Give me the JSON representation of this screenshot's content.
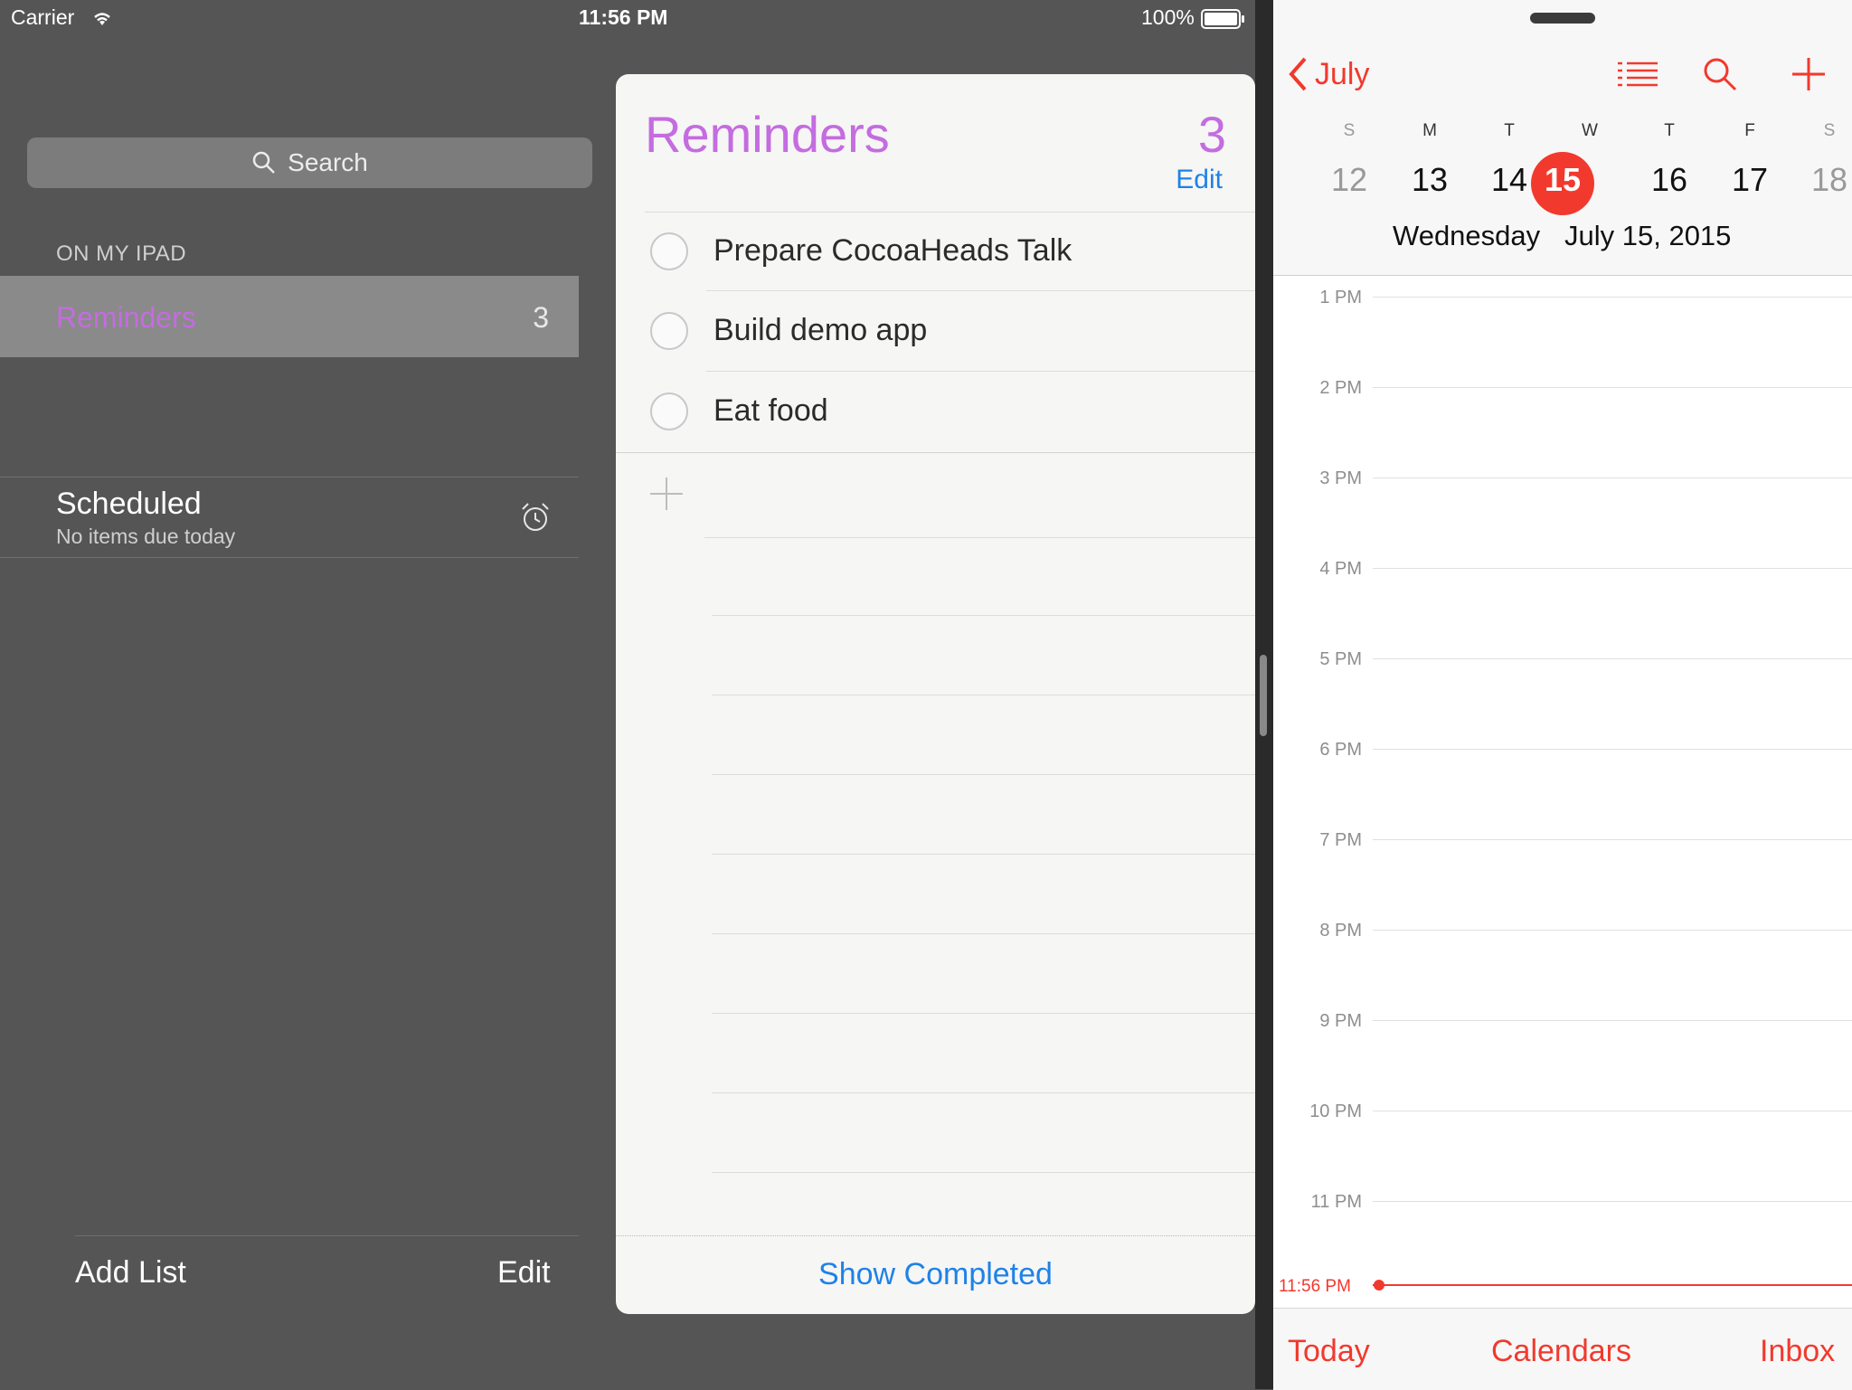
{
  "status_bar": {
    "carrier": "Carrier",
    "time": "11:56 PM",
    "battery": "100%"
  },
  "sidebar": {
    "search_placeholder": "Search",
    "section_header": "ON MY IPAD",
    "lists": [
      {
        "name": "Reminders",
        "count": "3"
      }
    ],
    "scheduled": {
      "title": "Scheduled",
      "subtitle": "No items due today",
      "icon": "alarm-clock-icon"
    },
    "footer": {
      "add_list": "Add List",
      "edit": "Edit"
    }
  },
  "reminders": {
    "title": "Reminders",
    "count": "3",
    "edit": "Edit",
    "items": [
      {
        "text": "Prepare CocoaHeads Talk",
        "completed": false
      },
      {
        "text": "Build demo app",
        "completed": false
      },
      {
        "text": "Eat food",
        "completed": false
      }
    ],
    "show_completed": "Show Completed",
    "accent": "#c46ce0",
    "link_color": "#1e82e8"
  },
  "calendar": {
    "month_back": "July",
    "day_letters": [
      "S",
      "M",
      "T",
      "W",
      "T",
      "F",
      "S"
    ],
    "day_numbers": [
      "12",
      "13",
      "14",
      "15",
      "16",
      "17",
      "18"
    ],
    "selected_day": "15",
    "date_weekday": "Wednesday",
    "date_full": "July 15, 2015",
    "hours": [
      "1 PM",
      "2 PM",
      "3 PM",
      "4 PM",
      "5 PM",
      "6 PM",
      "7 PM",
      "8 PM",
      "9 PM",
      "10 PM",
      "11 PM"
    ],
    "current_time": "11:56 PM",
    "footer": {
      "today": "Today",
      "calendars": "Calendars",
      "inbox": "Inbox"
    },
    "accent": "#f2392d"
  }
}
